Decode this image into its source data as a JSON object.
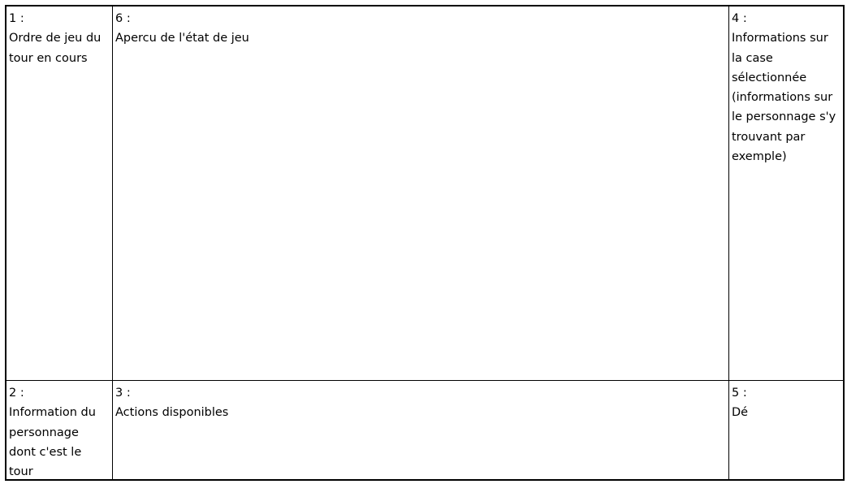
{
  "zones": {
    "top_left": {
      "number": "1 :",
      "text": "Ordre de jeu du tour en cours"
    },
    "top_center": {
      "number": "6 :",
      "text": "Apercu de l'état de jeu"
    },
    "top_right": {
      "number": "4 :",
      "text": "Informations sur la case sélectionnée (informations sur le personnage s'y trouvant par exemple)"
    },
    "bottom_left": {
      "number": "2 :",
      "text": "Information du personnage dont c'est le tour"
    },
    "bottom_center": {
      "number": "3 :",
      "text": "Actions disponibles"
    },
    "bottom_right": {
      "number": "5 :",
      "text": "Dé"
    }
  }
}
